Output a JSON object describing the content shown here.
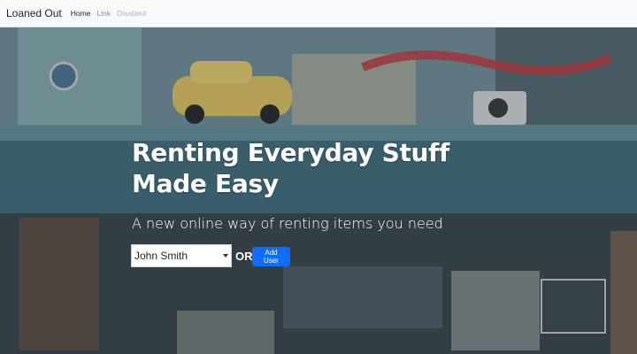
{
  "navbar": {
    "brand": "Loaned Out",
    "links": [
      "Home",
      "Link",
      "Disabled"
    ]
  },
  "hero": {
    "headline_line1": "Renting Everyday Stuff",
    "headline_line2": "Made Easy",
    "subheadline": "A new online way of renting items you need",
    "user_select": {
      "selected": "John Smith"
    },
    "or_label": "OR",
    "add_user_label": "Add User"
  },
  "colors": {
    "primary_button": "#0d6efd",
    "navbar_bg": "#f8f9fa",
    "hero_text": "#ffffff"
  }
}
